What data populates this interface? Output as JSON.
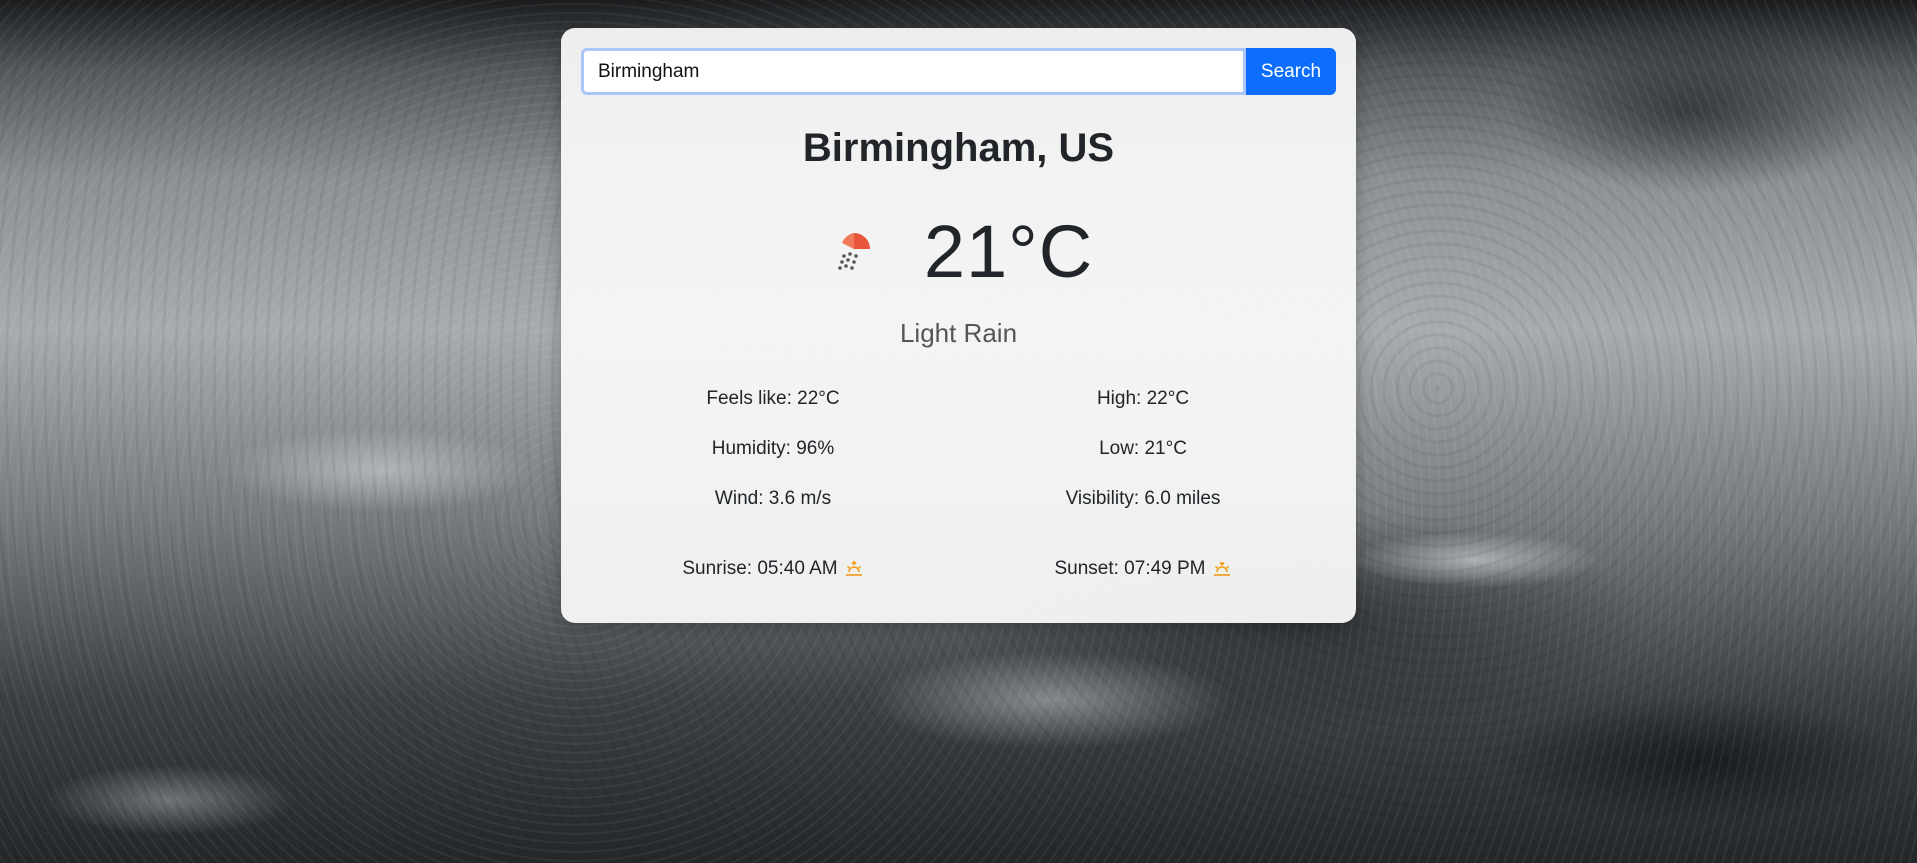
{
  "search": {
    "value": "Birmingham",
    "button_label": "Search"
  },
  "location": {
    "display": "Birmingham, US"
  },
  "current": {
    "temperature": "21°C",
    "description": "Light Rain",
    "icon": "light-rain-icon"
  },
  "stats": {
    "feels_like": "Feels like: 22°C",
    "humidity": "Humidity: 96%",
    "wind": "Wind: 3.6 m/s",
    "high": "High: 22°C",
    "low": "Low: 21°C",
    "visibility": "Visibility: 6.0 miles",
    "sunrise": "Sunrise: 05:40 AM",
    "sunset": "Sunset: 07:49 PM"
  },
  "colors": {
    "accent": "#0d6efd",
    "sun_icon": "#f39c12",
    "weather_icon": "#e8553a"
  }
}
